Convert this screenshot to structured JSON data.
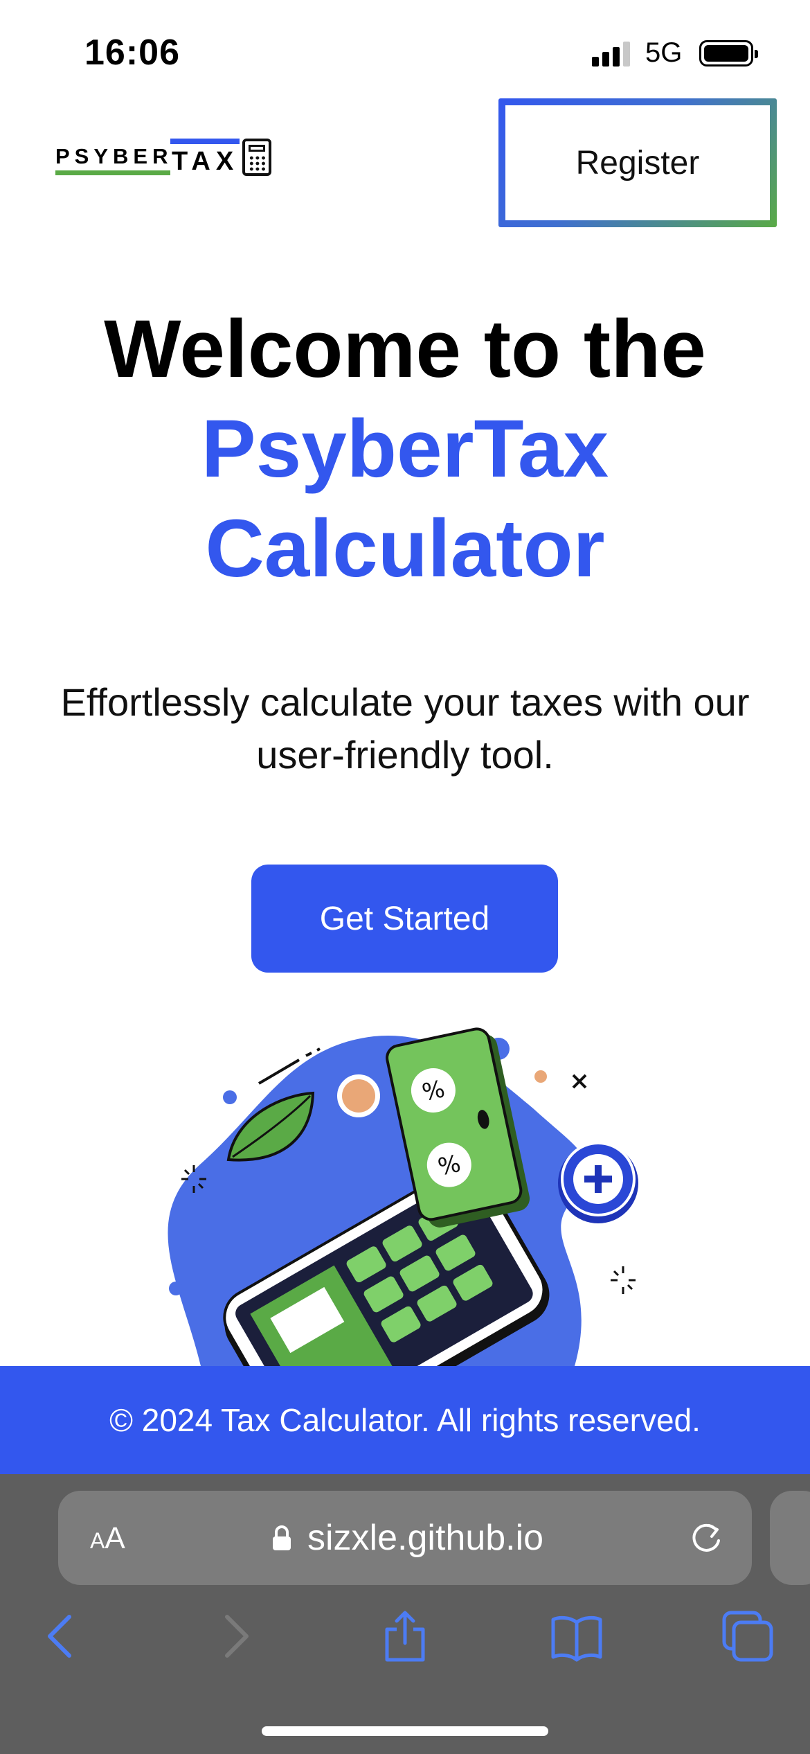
{
  "status_bar": {
    "time": "16:06",
    "network": "5G"
  },
  "header": {
    "logo": {
      "word1": "PSYBER",
      "word2": "TAX"
    },
    "register_label": "Register"
  },
  "hero": {
    "title_line1": "Welcome to the",
    "title_line2": "PsyberTax",
    "title_line3": "Calculator",
    "tagline": "Effortlessly calculate your taxes with our user-friendly tool.",
    "cta_label": "Get Started"
  },
  "footer": {
    "text": "© 2024 Tax Calculator. All rights reserved."
  },
  "browser": {
    "aa_small": "A",
    "aa_large": "A",
    "url": "sizxle.github.io",
    "toolbar": [
      "back-icon",
      "forward-icon",
      "share-icon",
      "bookmarks-icon",
      "tabs-icon"
    ]
  },
  "colors": {
    "brand_blue": "#3357ee",
    "brand_green": "#5aaa46",
    "footer_bg": "#3357ee",
    "browser_bg": "#5e5e5e"
  }
}
